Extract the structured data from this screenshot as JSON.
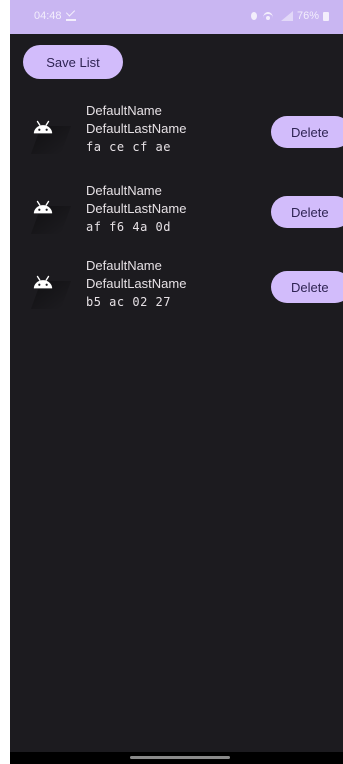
{
  "status_bar": {
    "time": "04:48",
    "battery": "76%"
  },
  "toolbar": {
    "save_label": "Save List"
  },
  "items": [
    {
      "first_name": "DefaultName",
      "last_name": "DefaultLastName",
      "hex": "fa ce cf ae",
      "delete_label": "Delete"
    },
    {
      "first_name": "DefaultName",
      "last_name": "DefaultLastName",
      "hex": "af f6 4a 0d",
      "delete_label": "Delete"
    },
    {
      "first_name": "DefaultName",
      "last_name": "DefaultLastName",
      "hex": "b5 ac 02 27",
      "delete_label": "Delete"
    }
  ],
  "icons": {
    "item_icon": "android-icon",
    "download_indicator": "download-done-icon"
  },
  "colors": {
    "accent": "#d2bcfb",
    "background": "#1c1b1f",
    "status_bar": "#c9b6f2",
    "text": "#e6e1e5"
  }
}
